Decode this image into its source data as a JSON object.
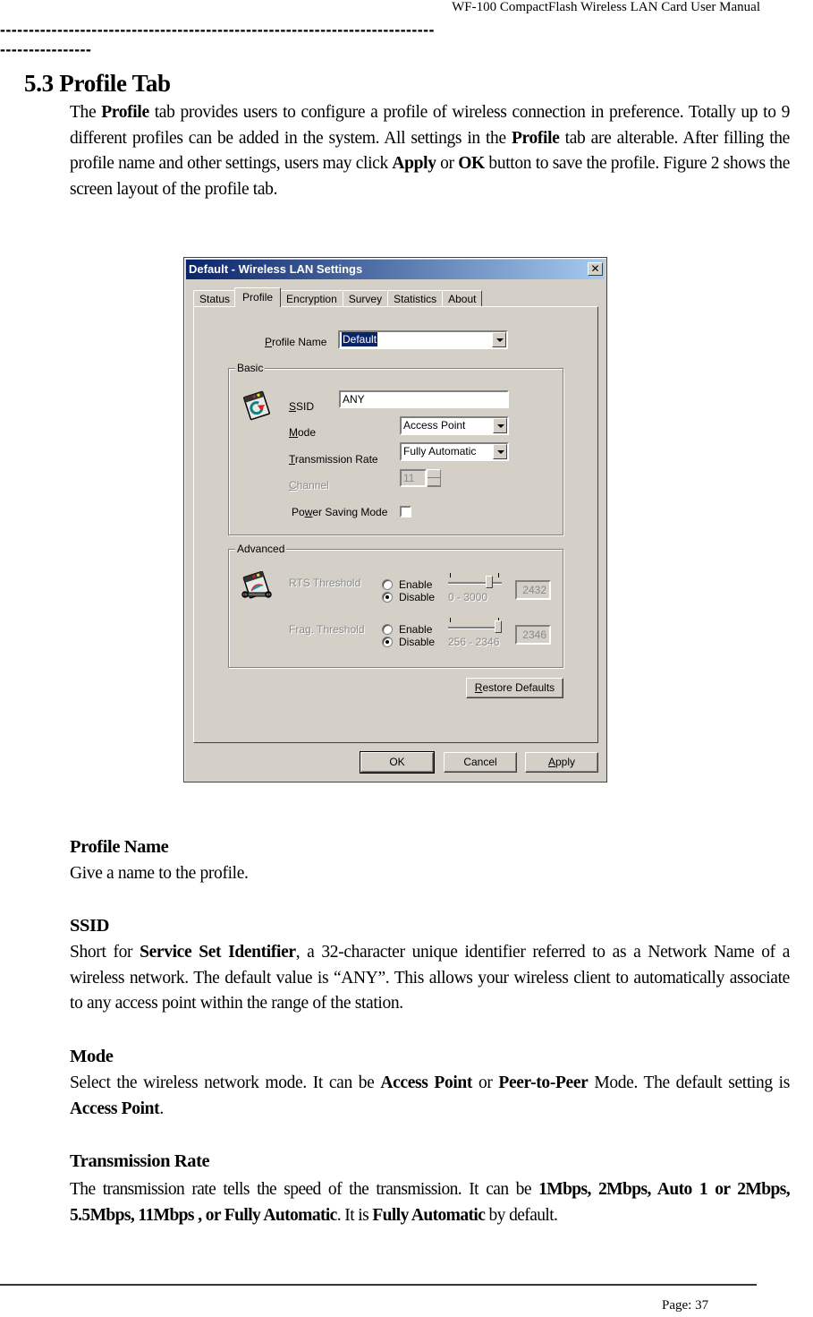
{
  "header": {
    "doc_title": "WF-100 CompactFlash Wireless LAN Card User Manual",
    "separator_line_1": "----------------------------------------------------------------------------",
    "separator_line_2": "----------------"
  },
  "section": {
    "title": "5.3 Profile Tab",
    "intro": {
      "p1": "The ",
      "b1": "Profile",
      "p2": " tab provides users to configure a profile of wireless connection in preference. Totally up to 9 different profiles can be added in the system. All settings in the ",
      "b2": "Profile",
      "p3": " tab are alterable. After filling the profile name and other settings, users may click ",
      "b3": "Apply",
      "p4": " or ",
      "b4": "OK",
      "p5": " button to save the profile. Figure 2 shows the screen layout of the profile tab."
    }
  },
  "dialog": {
    "title": "Default - Wireless LAN Settings",
    "close_glyph": "✕",
    "tabs": [
      {
        "label": "Status",
        "active": false
      },
      {
        "label": "Profile",
        "active": true
      },
      {
        "label": "Encryption",
        "active": false
      },
      {
        "label": "Survey",
        "active": false
      },
      {
        "label": "Statistics",
        "active": false
      },
      {
        "label": "About",
        "active": false
      }
    ],
    "profile_name": {
      "label_u": "P",
      "label_rest": "rofile Name",
      "value": "Default"
    },
    "basic": {
      "title": "Basic",
      "icon": "network-card-icon",
      "ssid": {
        "label_u": "S",
        "label_rest": "SID",
        "value": "ANY"
      },
      "mode": {
        "label_u": "M",
        "label_rest": "ode",
        "value": "Access Point"
      },
      "rate": {
        "label_u": "T",
        "label_rest": "ransmission Rate",
        "value": "Fully Automatic"
      },
      "channel": {
        "label_u": "C",
        "label_rest": "hannel",
        "value": "11",
        "disabled": true
      },
      "power_saving": {
        "label_pre": "Po",
        "label_u": "w",
        "label_rest": "er Saving Mode",
        "checked": false
      }
    },
    "advanced": {
      "title": "Advanced",
      "icon": "network-card-tools-icon",
      "rts": {
        "label": "RTS Threshold",
        "enable_label": "Enable",
        "disable_label": "Disable",
        "selected": "Disable",
        "range": "0 - 3000",
        "min": 0,
        "max": 3000,
        "value": "2432"
      },
      "frag": {
        "label": "Frag. Threshold",
        "enable_label": "Enable",
        "disable_label": "Disable",
        "selected": "Disable",
        "range": "256 - 2346",
        "min": 256,
        "max": 2346,
        "value": "2346"
      }
    },
    "restore_defaults": {
      "label_u": "R",
      "label_rest": "estore Defaults"
    },
    "buttons": {
      "ok": "OK",
      "cancel": "Cancel",
      "apply_u": "A",
      "apply_rest": "pply"
    }
  },
  "descriptions": {
    "profile_name": {
      "heading": "Profile Name",
      "text": "Give a name to the profile."
    },
    "ssid": {
      "heading": "SSID",
      "p1": "Short for ",
      "b1": "Service Set Identifier",
      "p2": ", a 32-character unique identifier referred to as a Network Name of a wireless network. The default value is “ANY”. This allows your wireless client to automatically associate to any access point within the range of the station."
    },
    "mode": {
      "heading": "Mode",
      "p1": "Select the wireless network mode. It can be ",
      "b1": "Access Point",
      "p2": " or ",
      "b2": "Peer-to-Peer",
      "p3": " Mode. The default setting is ",
      "b3": "Access Point",
      "p4": "."
    },
    "rate": {
      "heading": "Transmission Rate",
      "p1": "The transmission rate tells the speed of the transmission. It can be ",
      "b1": "1Mbps, 2Mbps, Auto 1 or 2Mbps, 5.5Mbps, 11Mbps , or Fully Automatic",
      "p2": ". It is ",
      "b2": "Fully Automatic",
      "p3": " by default."
    }
  },
  "footer": {
    "page": "Page: 37"
  }
}
